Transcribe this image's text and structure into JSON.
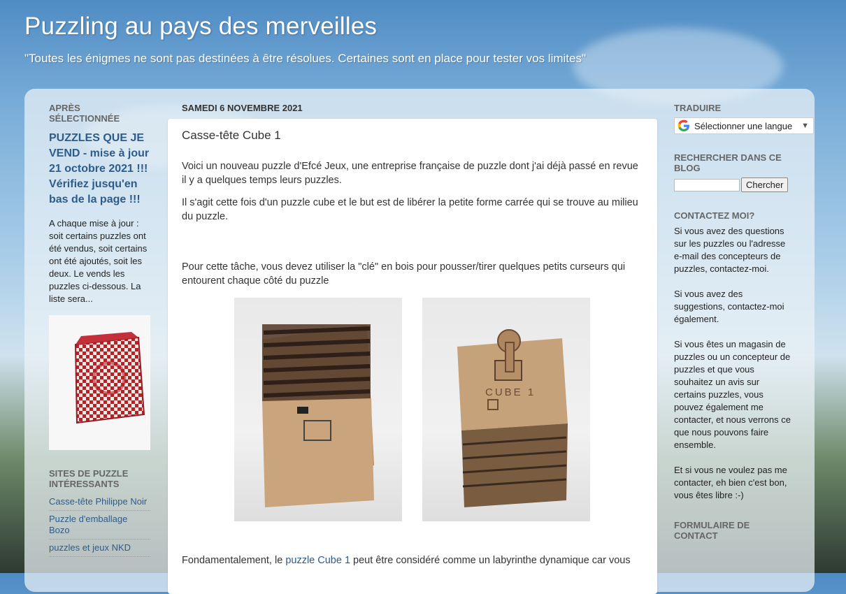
{
  "header": {
    "title": "Puzzling au pays des merveilles",
    "description": "\"Toutes les énigmes ne sont pas destinées à être résolues. Certaines sont en place pour tester vos limites\""
  },
  "left": {
    "featured_title": "APRÈS SÉLECTIONNÉE",
    "featured_post_title": "PUZZLES QUE JE VEND - mise à jour 21 octobre 2021 !!! Vérifiez jusqu'en bas de la page !!!",
    "featured_snippet": "A chaque mise à jour : soit certains puzzles ont été vendus, soit certains ont été ajoutés, soit les deux. Le vends les puzzles ci-dessous. La liste sera...",
    "sites_title": "SITES DE PUZZLE INTÉRESSANTS",
    "sites": [
      "Casse-tête Philippe Noir",
      "Puzzle d'emballage Bozo",
      "puzzles et jeux NKD"
    ]
  },
  "main": {
    "date": "SAMEDI 6 NOVEMBRE 2021",
    "post_title": "Casse-tête Cube 1",
    "paragraphs": [
      "Voici un nouveau puzzle d'Efcé Jeux, une entreprise française de puzzle dont j'ai déjà passé en revue il y a quelques temps leurs puzzles.",
      "Il s'agit cette fois d'un puzzle cube et le but est de libérer la petite forme carrée qui se trouve au milieu du puzzle.",
      "Pour cette tâche, vous devez utiliser la \"clé\" en bois pour pousser/tirer quelques petits curseurs qui entourent chaque côté du puzzle"
    ],
    "last_paragraph_before": "Fondamentalement, le ",
    "last_paragraph_link": "puzzle Cube 1",
    "last_paragraph_after": " peut être considéré comme un labyrinthe dynamique car vous",
    "photo2_engraving": "CUBE 1"
  },
  "right": {
    "translate_title": "TRADUIRE",
    "translate_label": "Sélectionner une langue",
    "search_title": "RECHERCHER DANS CE BLOG",
    "search_button": "Chercher",
    "contact_title": "CONTACTEZ MOI?",
    "contact_paragraphs": [
      "Si vous avez des questions sur les puzzles ou l'adresse e-mail des concepteurs de puzzles, contactez-moi.",
      "Si vous avez des suggestions, contactez-moi également.",
      "Si vous êtes un magasin de puzzles ou un concepteur de puzzles et que vous souhaitez un avis sur certains puzzles, vous pouvez également me contacter, et nous verrons ce que nous pouvons faire ensemble.",
      "Et si vous ne voulez pas me contacter, eh bien c'est bon, vous êtes libre :-)"
    ],
    "form_title": "FORMULAIRE DE CONTACT"
  }
}
